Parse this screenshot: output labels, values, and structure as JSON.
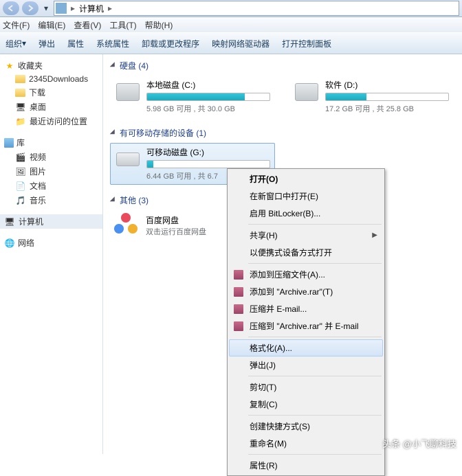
{
  "breadcrumb": {
    "root": "计算机"
  },
  "menu": {
    "file": "文件(F)",
    "edit": "编辑(E)",
    "view": "查看(V)",
    "tools": "工具(T)",
    "help": "帮助(H)"
  },
  "toolbar": {
    "organize": "组织",
    "eject": "弹出",
    "properties": "属性",
    "sysprops": "系统属性",
    "uninstall": "卸载或更改程序",
    "mapdrive": "映射网络驱动器",
    "ctrlpanel": "打开控制面板"
  },
  "sidebar": {
    "favorites": "收藏夹",
    "downloads": "2345Downloads",
    "download": "下载",
    "desktop": "桌面",
    "recent": "最近访问的位置",
    "library": "库",
    "video": "视频",
    "pictures": "图片",
    "documents": "文档",
    "music": "音乐",
    "computer": "计算机",
    "network": "网络"
  },
  "content": {
    "hdd_header": "硬盘 (4)",
    "drives": [
      {
        "name": "本地磁盘 (C:)",
        "stat": "5.98 GB 可用 , 共 30.0 GB",
        "fill": 80
      },
      {
        "name": "软件 (D:)",
        "stat": "17.2 GB 可用 , 共 25.8 GB",
        "fill": 33
      }
    ],
    "removable_header": "有可移动存储的设备 (1)",
    "removable": {
      "name": "可移动磁盘 (G:)",
      "stat": "6.44 GB 可用 , 共 6.7",
      "fill": 5
    },
    "other_header": "其他 (3)",
    "app": {
      "name": "百度网盘",
      "sub": "双击运行百度网盘"
    }
  },
  "context": {
    "open": "打开(O)",
    "newwin": "在新窗口中打开(E)",
    "bitlocker": "启用 BitLocker(B)...",
    "share": "共享(H)",
    "portable": "以便携式设备方式打开",
    "addarchive": "添加到压缩文件(A)...",
    "addto_archive": "添加到 \"Archive.rar\"(T)",
    "compress_email": "压缩并 E-mail...",
    "compress_to_email": "压缩到 \"Archive.rar\" 并 E-mail",
    "format": "格式化(A)...",
    "eject": "弹出(J)",
    "cut": "剪切(T)",
    "copy": "复制(C)",
    "shortcut": "创建快捷方式(S)",
    "rename": "重命名(M)",
    "props": "属性(R)"
  },
  "watermark": "头条 @小飞聊科技"
}
